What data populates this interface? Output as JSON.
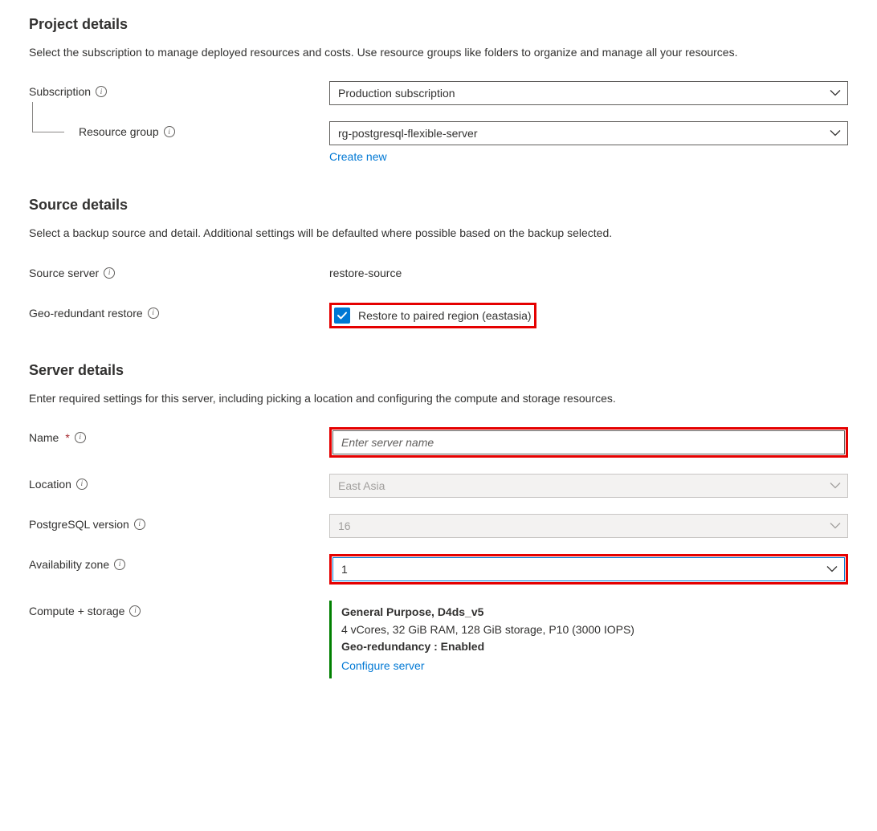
{
  "project": {
    "heading": "Project details",
    "description": "Select the subscription to manage deployed resources and costs. Use resource groups like folders to organize and manage all your resources.",
    "subscription_label": "Subscription",
    "subscription_value": "Production subscription",
    "resource_group_label": "Resource group",
    "resource_group_value": "rg-postgresql-flexible-server",
    "create_new": "Create new"
  },
  "source": {
    "heading": "Source details",
    "description": "Select a backup source and detail. Additional settings will be defaulted where possible based on the backup selected.",
    "source_server_label": "Source server",
    "source_server_value": "restore-source",
    "geo_restore_label": "Geo-redundant restore",
    "geo_checkbox_label": "Restore to paired region (eastasia)"
  },
  "server": {
    "heading": "Server details",
    "description": "Enter required settings for this server, including picking a location and configuring the compute and storage resources.",
    "name_label": "Name",
    "name_placeholder": "Enter server name",
    "location_label": "Location",
    "location_value": "East Asia",
    "version_label": "PostgreSQL version",
    "version_value": "16",
    "az_label": "Availability zone",
    "az_value": "1",
    "compute_label": "Compute + storage",
    "compute_title": "General Purpose, D4ds_v5",
    "compute_spec": "4 vCores, 32 GiB RAM, 128 GiB storage, P10 (3000 IOPS)",
    "compute_geo": "Geo-redundancy : Enabled",
    "configure_link": "Configure server"
  }
}
